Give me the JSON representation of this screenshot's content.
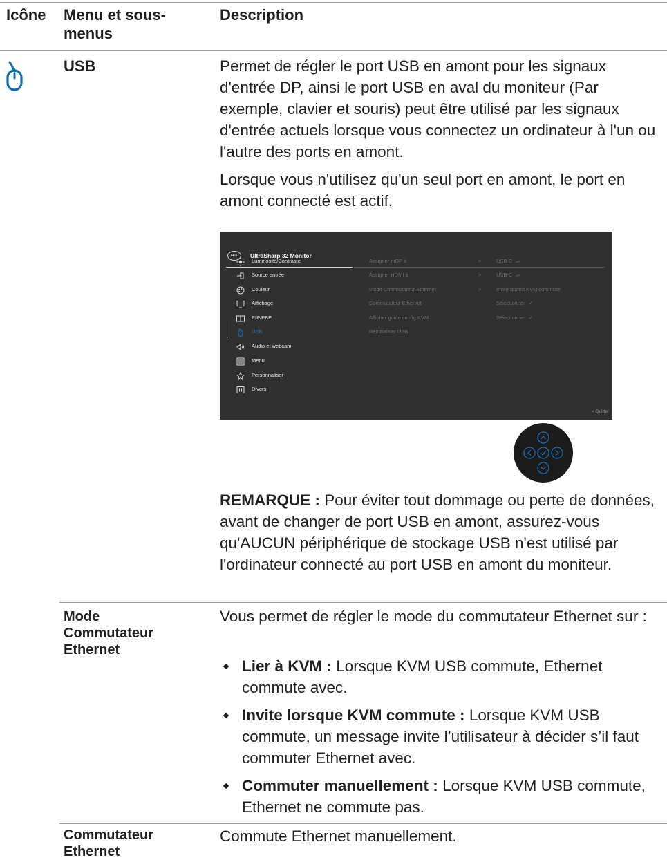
{
  "headers": {
    "icon": "Icône",
    "menu": "Menu et sous-menus",
    "description": "Description"
  },
  "usb": {
    "icon": "mouse-icon",
    "name": "USB",
    "para1": "Permet de régler le port USB en amont pour les signaux d'entrée DP, ainsi le port USB en aval du moniteur (Par exemple, clavier et souris) peut être utilisé par les signaux d'entrée actuels lorsque vous connectez un ordinateur à l'un ou l'autre des ports en amont.",
    "para2": "Lorsque vous n'utilisez qu'un seul port en amont, le port en amont connecté est actif.",
    "note_label": "REMARQUE :",
    "note_text": " Pour éviter tout dommage ou perte de données, avant de changer de port USB en amont, assurez-vous qu'AUCUN périphérique de stockage USB n'est utilisé par l'ordinateur connecté au port USB en amont du moniteur."
  },
  "osd": {
    "brand": "DELL",
    "model": "UltraSharp 32 Monitor",
    "accent": "#1d6fbf",
    "menu": [
      {
        "icon": "brightness-icon",
        "label": "Luminosité/Contraste"
      },
      {
        "icon": "input-source-icon",
        "label": "Source entrée"
      },
      {
        "icon": "palette-icon",
        "label": "Couleur"
      },
      {
        "icon": "display-icon",
        "label": "Affichage"
      },
      {
        "icon": "pip-icon",
        "label": "PIP/PBP"
      },
      {
        "icon": "mouse-icon",
        "label": "USB"
      },
      {
        "icon": "speaker-icon",
        "label": "Audio et webcam"
      },
      {
        "icon": "menu-icon",
        "label": "Menu"
      },
      {
        "icon": "star-icon",
        "label": "Personnaliser"
      },
      {
        "icon": "others-icon",
        "label": "Divers"
      }
    ],
    "options": [
      {
        "label": "Assigner mDP à",
        "arrow": ">",
        "value": "USB-C",
        "value_icon": "usb-icon"
      },
      {
        "label": "Assigner HDMI à",
        "arrow": ">",
        "value": "USB-C",
        "value_icon": "usb-icon"
      },
      {
        "label": "Mode Commutateur Ethernet",
        "arrow": ">",
        "value": "Invite quand KVM commute",
        "value_icon": ""
      },
      {
        "label": "Commutateur Ethernet",
        "arrow": "",
        "value": "Sélectionner",
        "value_icon": "check-icon"
      },
      {
        "label": "Afficher guide config KVM",
        "arrow": "",
        "value": "Sélectionner",
        "value_icon": "check-icon"
      },
      {
        "label": "Réinitialiser USB",
        "arrow": "",
        "value": "",
        "value_icon": ""
      }
    ],
    "quit": "< Quitter"
  },
  "ethernet_mode": {
    "name": "Mode Commutateur Ethernet",
    "intro": "Vous permet de régler le mode du commutateur Ethernet sur :",
    "bullets": [
      {
        "term": "Lier à KVM :",
        "text": " Lorsque KVM USB commute, Ethernet commute avec."
      },
      {
        "term": "Invite lorsque KVM commute :",
        "text": " Lorsque KVM USB commute, un message invite l’utilisateur à décider s’il faut commuter Ethernet avec."
      },
      {
        "term": "Commuter manuellement :",
        "text": " Lorsque KVM USB commute, Ethernet ne commute pas."
      }
    ]
  },
  "ethernet_switch": {
    "name": "Commutateur Ethernet",
    "text": "Commute Ethernet manuellement."
  }
}
